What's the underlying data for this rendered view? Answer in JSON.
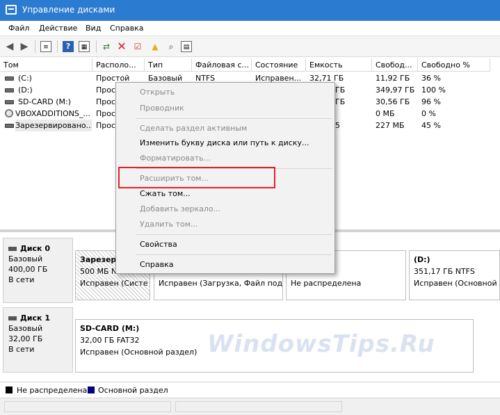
{
  "window": {
    "title": "Управление дисками",
    "accent": "#2b7bd1"
  },
  "menu": [
    "Файл",
    "Действие",
    "Вид",
    "Справка"
  ],
  "toolbar_icons": [
    "back-arrow-icon",
    "forward-arrow-icon",
    "list-view-icon",
    "help-icon",
    "properties-icon",
    "connect-icon",
    "delete-icon",
    "check-icon",
    "refresh-icon",
    "search-icon",
    "window-icon"
  ],
  "table": {
    "columns": [
      "Том",
      "Располо...",
      "Тип",
      "Файловая с...",
      "Состояние",
      "Емкость",
      "Свобод...",
      "Свободно %"
    ],
    "rows": [
      {
        "name": "(C:)",
        "layout": "Простой",
        "type": "Базовый",
        "fs": "NTFS",
        "status": "Исправен...",
        "capacity": "32,71 ГБ",
        "free": "11,92 ГБ",
        "pct": "36 %"
      },
      {
        "name": "(D:)",
        "layout": "Просто",
        "type": "",
        "fs": "",
        "status": "",
        "capacity": "ГБ",
        "free": "349,97 ГБ",
        "pct": "100 %"
      },
      {
        "name": "SD-CARD (M:)",
        "layout": "Просто",
        "type": "",
        "fs": "",
        "status": "",
        "capacity": "ГБ",
        "free": "30,56 ГБ",
        "pct": "96 %"
      },
      {
        "name": "VBOXADDITIONS_...",
        "layout": "Просто",
        "type": "",
        "fs": "",
        "status": "",
        "capacity": "",
        "free": "0 МБ",
        "pct": "0 %"
      },
      {
        "name": "Зарезервировано...",
        "layout": "Просто",
        "type": "",
        "fs": "",
        "status": "",
        "capacity": "5",
        "free": "227 МБ",
        "pct": "45 %"
      }
    ]
  },
  "disks": [
    {
      "name": "Диск 0",
      "type": "Базовый",
      "size": "400,00 ГБ",
      "state": "В сети",
      "parts": [
        {
          "title": "Зарезер",
          "line2": "500 МБ N",
          "line3": "Исправен (Систе"
        },
        {
          "title": "",
          "line2": "",
          "line3": "Исправен (Загрузка, Файл подк"
        },
        {
          "title": "",
          "line2": "",
          "line3": "Не распределена"
        },
        {
          "title": "(D:)",
          "line2": "351,17 ГБ NTFS",
          "line3": "Исправен (Основной р"
        }
      ]
    },
    {
      "name": "Диск 1",
      "type": "Базовый",
      "size": "32,00 ГБ",
      "state": "В сети",
      "parts": [
        {
          "title": "SD-CARD  (M:)",
          "line2": "32,00 ГБ FAT32",
          "line3": "Исправен (Основной раздел)"
        }
      ]
    }
  ],
  "legend": [
    {
      "label": "Не распределена",
      "color": "#000000"
    },
    {
      "label": "Основной раздел",
      "color": "#000080"
    }
  ],
  "context_menu": {
    "items": [
      {
        "label": "Открыть",
        "disabled": true
      },
      {
        "label": "Проводник",
        "disabled": true
      },
      {
        "label": "Сделать раздел активным",
        "disabled": true
      },
      {
        "label": "Изменить букву диска или путь к диску...",
        "disabled": false
      },
      {
        "label": "Форматировать...",
        "disabled": true
      },
      {
        "label": "Расширить том...",
        "disabled": true
      },
      {
        "label": "Сжать том...",
        "disabled": false
      },
      {
        "label": "Добавить зеркало...",
        "disabled": true
      },
      {
        "label": "Удалить том...",
        "disabled": true
      },
      {
        "label": "Свойства",
        "disabled": false
      },
      {
        "label": "Справка",
        "disabled": false
      }
    ],
    "highlight_color": "#e3202a"
  },
  "watermark": "WindowsTips.Ru"
}
